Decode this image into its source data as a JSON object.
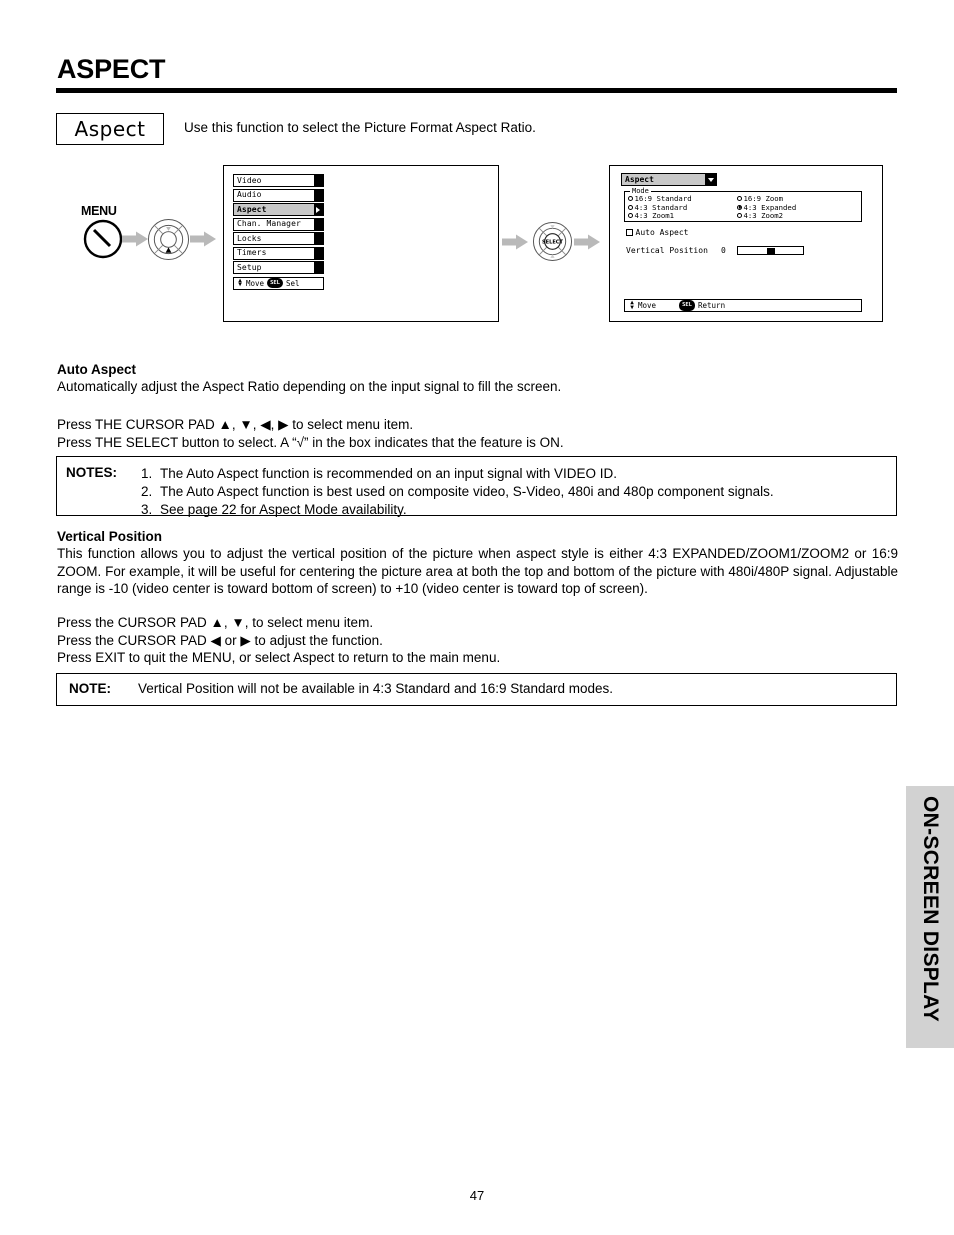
{
  "page": {
    "title": "ASPECT",
    "number": "47",
    "side_tab": "ON-SCREEN DISPLAY"
  },
  "header": {
    "badge": "Aspect",
    "intro": "Use this function to select the Picture Format Aspect Ratio."
  },
  "diagram": {
    "menu_button_label": "MENU",
    "select_button_label": "SELECT",
    "osd_main": {
      "items": [
        {
          "label": "Video",
          "selected": false
        },
        {
          "label": "Audio",
          "selected": false
        },
        {
          "label": "Aspect",
          "selected": true
        },
        {
          "label": "Chan. Manager",
          "selected": false
        },
        {
          "label": "Locks",
          "selected": false
        },
        {
          "label": "Timers",
          "selected": false
        },
        {
          "label": "Setup",
          "selected": false
        }
      ],
      "footer_move": "Move",
      "footer_sel_key": "SEL",
      "footer_sel_action": "Sel"
    },
    "osd_aspect": {
      "title": "Aspect",
      "mode_legend": "Mode",
      "modes_left": [
        {
          "label": "16:9 Standard",
          "selected": false
        },
        {
          "label": "4:3 Standard",
          "selected": false
        },
        {
          "label": "4:3 Zoom1",
          "selected": false
        }
      ],
      "modes_right": [
        {
          "label": "16:9 Zoom",
          "selected": false
        },
        {
          "label": "4:3 Expanded",
          "selected": true
        },
        {
          "label": "4:3 Zoom2",
          "selected": false
        }
      ],
      "auto_aspect_label": "Auto Aspect",
      "auto_aspect_checked": false,
      "vertical_position_label": "Vertical Position",
      "vertical_position_value": "0",
      "footer_move": "Move",
      "footer_sel_key": "SEL",
      "footer_sel_action": "Return"
    }
  },
  "sections": {
    "auto_aspect": {
      "heading": "Auto Aspect",
      "body": "Automatically adjust the Aspect Ratio depending on the input signal to fill the screen.",
      "press_line_1": "Press THE CURSOR PAD ▲, ▼, ◀, ▶ to select menu item.",
      "press_line_2": "Press THE SELECT button to select.  A “√” in the box indicates that the feature is ON."
    },
    "notes": {
      "label": "NOTES:",
      "items": [
        {
          "num": "1.",
          "text": "The Auto Aspect function is recommended on an input signal with VIDEO ID."
        },
        {
          "num": "2.",
          "text": "The Auto Aspect function is best used on composite video, S-Video, 480i and 480p component signals."
        },
        {
          "num": "3.",
          "text": "See page 22 for Aspect Mode availability."
        }
      ]
    },
    "vertical_position": {
      "heading": "Vertical Position",
      "body": "This function allows you to adjust the vertical position of the picture when aspect style is either 4:3 EXPANDED/ZOOM1/ZOOM2 or 16:9 ZOOM.  For example, it will be useful for centering the picture area at both the top and bottom of the picture with 480i/480P signal. Adjustable range is -10 (video center is toward bottom of screen) to +10 (video center is toward top of screen).",
      "press_line_1": "Press the CURSOR PAD ▲, ▼, to select menu item.",
      "press_line_2": "Press the CURSOR PAD  ◀ or ▶ to adjust the function.",
      "press_line_3": "Press EXIT to quit the MENU, or select Aspect to return to the main menu."
    },
    "note": {
      "label": "NOTE:",
      "text": "Vertical Position will not be available in 4:3 Standard and 16:9 Standard modes."
    }
  },
  "colors": {
    "rule": "#000000",
    "highlight": "#c8c8c8",
    "side_tab": "#d2d2d2"
  }
}
